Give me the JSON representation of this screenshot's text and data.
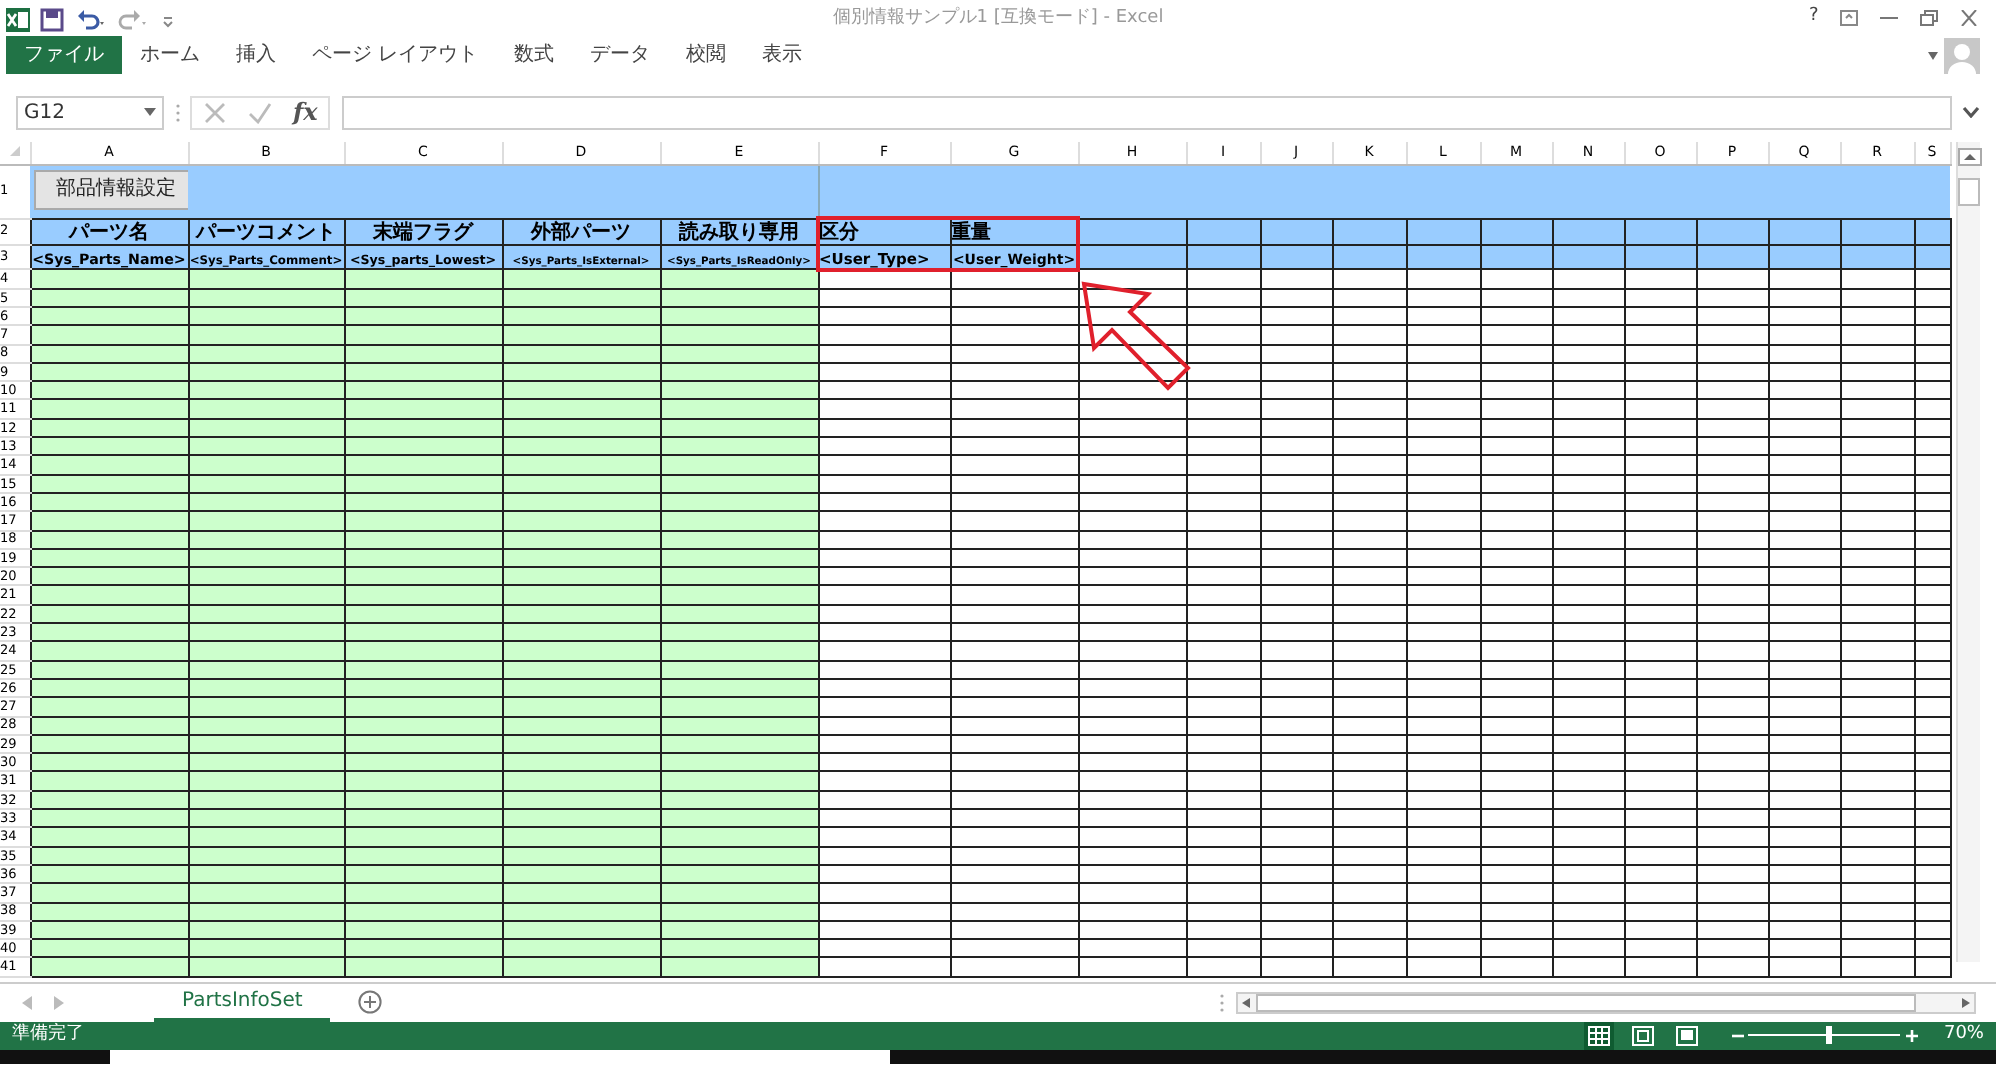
{
  "window": {
    "title": "個別情報サンプル1 [互換モード] - Excel",
    "help": "?"
  },
  "ribbon_tabs": [
    {
      "label": "ファイル",
      "kind": "file",
      "selected": false
    },
    {
      "label": "ホーム",
      "kind": "tab",
      "selected": false
    },
    {
      "label": "挿入",
      "kind": "tab",
      "selected": false
    },
    {
      "label": "ページ レイアウト",
      "kind": "tab",
      "selected": false
    },
    {
      "label": "数式",
      "kind": "tab",
      "selected": false
    },
    {
      "label": "データ",
      "kind": "tab",
      "selected": false
    },
    {
      "label": "校閲",
      "kind": "tab",
      "selected": false
    },
    {
      "label": "表示",
      "kind": "tab",
      "selected": false
    }
  ],
  "formula_bar": {
    "name_box": "G12",
    "fx": "fx"
  },
  "sheet": {
    "columns": [
      {
        "label": "A",
        "color": "#ccffcc"
      },
      {
        "label": "B",
        "color": "#ccffcc"
      },
      {
        "label": "C",
        "color": "#ccffcc"
      },
      {
        "label": "D",
        "color": "#ccffcc"
      },
      {
        "label": "E",
        "color": "#ccffcc"
      },
      {
        "label": "F",
        "color": "#ffffff"
      },
      {
        "label": "G",
        "color": "#ffffff"
      },
      {
        "label": "H",
        "color": "#ffffff"
      },
      {
        "label": "I",
        "color": "#ffffff"
      },
      {
        "label": "J",
        "color": "#ffffff"
      },
      {
        "label": "K",
        "color": "#ffffff"
      },
      {
        "label": "L",
        "color": "#ffffff"
      },
      {
        "label": "M",
        "color": "#ffffff"
      },
      {
        "label": "N",
        "color": "#ffffff"
      },
      {
        "label": "O",
        "color": "#ffffff"
      },
      {
        "label": "P",
        "color": "#ffffff"
      },
      {
        "label": "Q",
        "color": "#ffffff"
      },
      {
        "label": "R",
        "color": "#ffffff"
      },
      {
        "label": "S",
        "color": "#ffffff"
      }
    ],
    "row_numbers": [
      "1",
      "2",
      "3",
      "4",
      "5",
      "6",
      "7",
      "8",
      "9",
      "10",
      "11",
      "12",
      "13",
      "14",
      "15",
      "16",
      "17",
      "18",
      "19",
      "20",
      "21",
      "22",
      "23",
      "24",
      "25",
      "26",
      "27",
      "28",
      "29",
      "30",
      "31",
      "32",
      "33",
      "34",
      "35",
      "36",
      "37",
      "38",
      "39",
      "40",
      "41"
    ],
    "button": "部品情報設定",
    "header_row": [
      "パーツ名",
      "パーツコメント",
      "末端フラグ",
      "外部パーツ",
      "読み取り専用",
      "区分",
      "重量"
    ],
    "tag_row": [
      "<Sys_Parts_Name>",
      "<Sys_Parts_Comment>",
      "<Sys_parts_Lowest>",
      "<Sys_Parts_IsExternal>",
      "<Sys_Parts_IsReadOnly>",
      "<User_Type>",
      "<User_Weight>"
    ],
    "callout": {
      "highlight_box": true,
      "arrow": true
    }
  },
  "sheet_tabs": [
    {
      "label": "PartsInfoSet",
      "selected": true
    }
  ],
  "status_bar": {
    "text": "準備完了",
    "views": [
      {
        "kind": "normal",
        "selected": true
      },
      {
        "kind": "page-layout",
        "selected": false
      },
      {
        "kind": "page-break",
        "selected": false
      }
    ],
    "zoom": {
      "level": 0.53,
      "reading": "70%"
    }
  }
}
